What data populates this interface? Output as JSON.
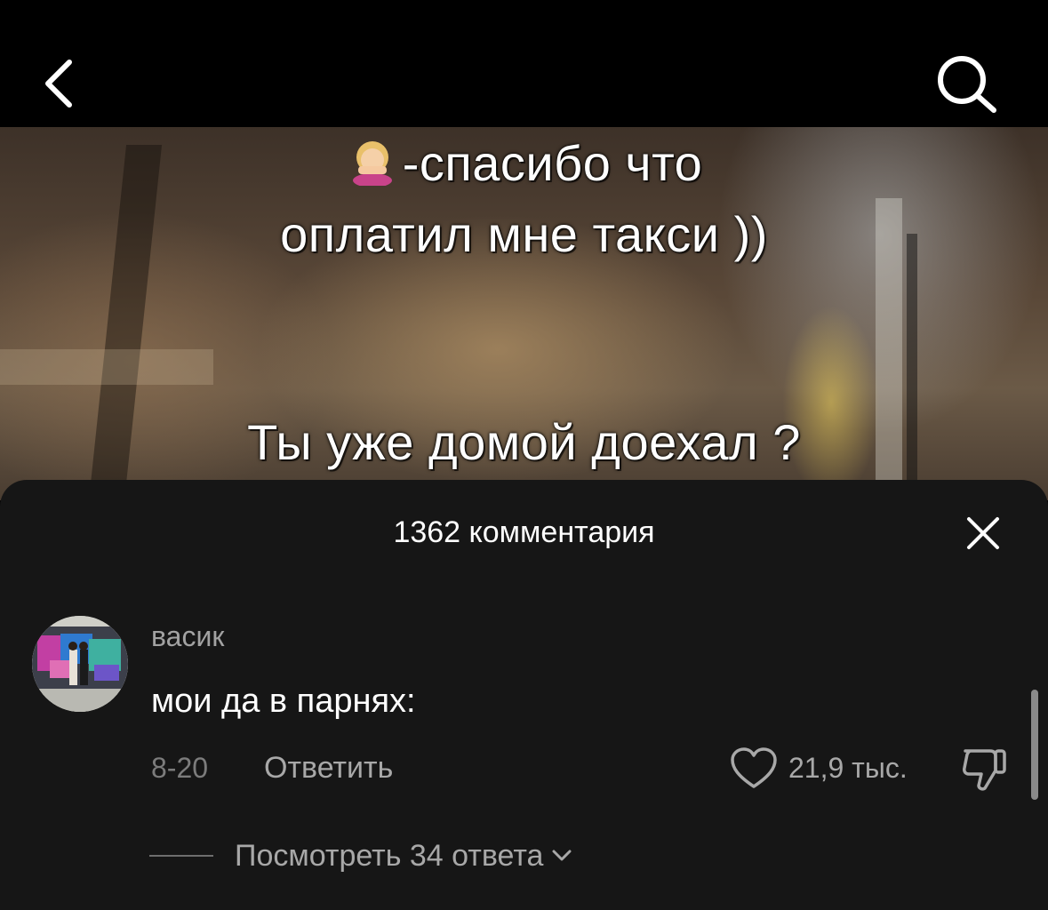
{
  "header": {
    "back_icon": "chevron-left-icon",
    "search_icon": "search-icon"
  },
  "video": {
    "caption_emoji": "woman-facepalming-emoji",
    "caption_line1": "-спасибо что",
    "caption_line2": "оплатил мне такси ))",
    "caption_line3": "Ты уже домой доехал ?"
  },
  "comments": {
    "title": "1362 комментария",
    "close_icon": "close-icon",
    "items": [
      {
        "username": "васик",
        "text": "мои да в парнях:",
        "date": "8-20",
        "reply_label": "Ответить",
        "likes": "21,9 тыс.",
        "view_replies": "Посмотреть 34 ответа"
      }
    ]
  },
  "colors": {
    "sheet_bg": "#161616",
    "muted_text": "#a8a8a8",
    "date_text": "#7c7c7c"
  }
}
